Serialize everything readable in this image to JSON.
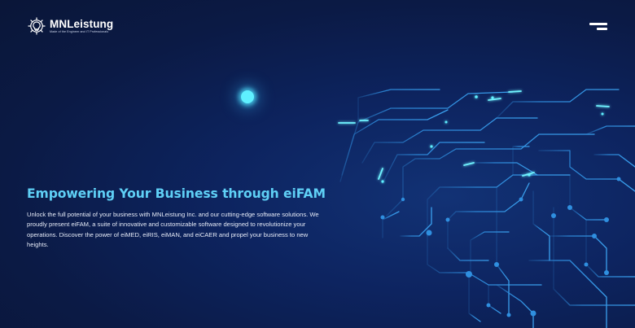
{
  "header": {
    "brand_name": "MNLeistung",
    "brand_tagline": "Made of the Engineer and IT Professionals",
    "logo_icon": "gear-bulb-icon",
    "menu_icon": "hamburger-menu-icon"
  },
  "hero": {
    "title": "Empowering Your Business through eiFAM",
    "description": "Unlock the full potential of your business with MNLeistung Inc. and our cutting-edge software solutions. We proudly present eiFAM, a suite of innovative and customizable software designed to revolutionize your operations. Discover the power of eiMED, eiRIS, eiMAN, and eiCAER and propel your business to new heights."
  },
  "colors": {
    "background": "#0b1a45",
    "accent_cyan": "#5fd0f6",
    "circuit_line": "#2f8fe0",
    "glow": "#5ff0ff"
  }
}
